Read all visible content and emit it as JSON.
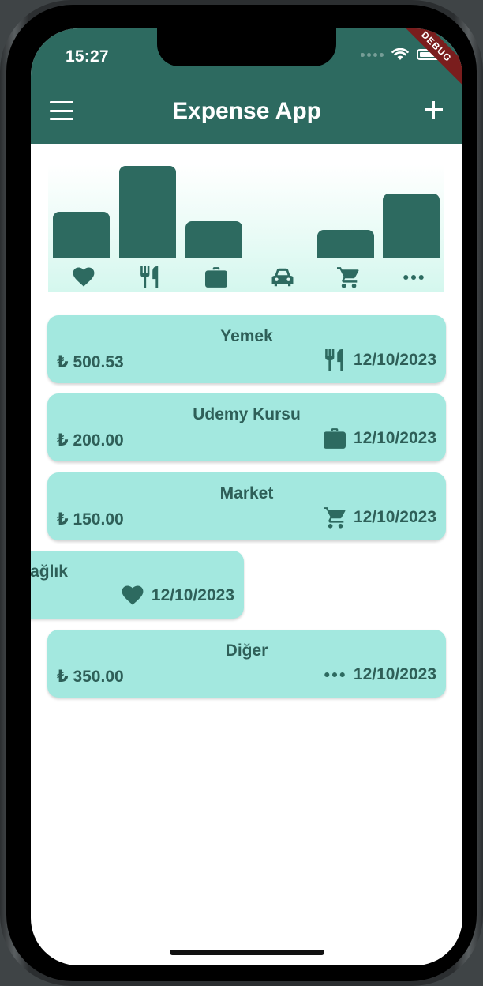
{
  "status_bar": {
    "time": "15:27",
    "debug_label": "DEBUG"
  },
  "app_bar": {
    "title": "Expense App",
    "menu_icon": "menu-icon",
    "add_icon": "add-icon"
  },
  "colors": {
    "primary": "#2d6a60",
    "card": "#a3e8df",
    "text": "#2e5f58",
    "debug": "#7a1d1d"
  },
  "chart_data": {
    "type": "bar",
    "categories": [
      "health",
      "food",
      "work",
      "car",
      "shopping",
      "other"
    ],
    "icons": [
      "heart-icon",
      "fork-knife-icon",
      "briefcase-icon",
      "car-icon",
      "cart-icon",
      "more-icon"
    ],
    "values": [
      0.5,
      1.0,
      0.4,
      0,
      0.3,
      0.7
    ]
  },
  "expenses": [
    {
      "title": "Yemek",
      "amount": "₺ 500.53",
      "icon": "fork-knife-icon",
      "date": "12/10/2023"
    },
    {
      "title": "Udemy Kursu",
      "amount": "₺ 200.00",
      "icon": "briefcase-icon",
      "date": "12/10/2023"
    },
    {
      "title": "Market",
      "amount": "₺ 150.00",
      "icon": "cart-icon",
      "date": "12/10/2023"
    },
    {
      "title": "ağlık",
      "amount": "",
      "icon": "heart-icon",
      "date": "12/10/2023"
    },
    {
      "title": "Diğer",
      "amount": "₺ 350.00",
      "icon": "more-icon",
      "date": "12/10/2023"
    }
  ]
}
